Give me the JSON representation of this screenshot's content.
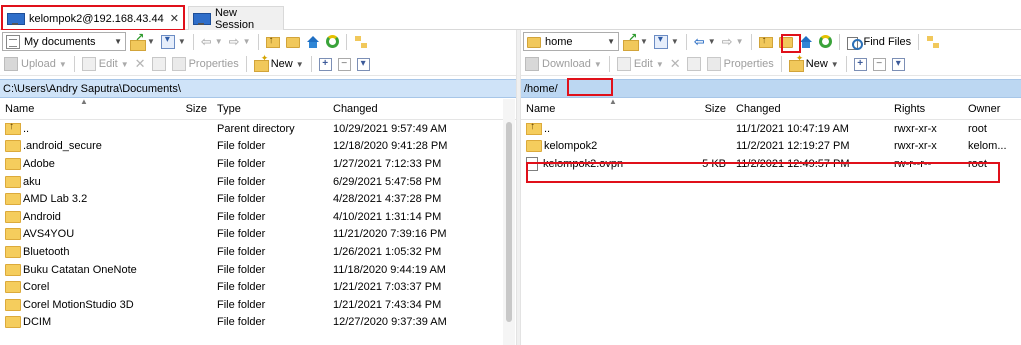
{
  "tabs": {
    "session_tab": "kelompok2@192.168.43.44",
    "close_glyph": "✕",
    "new_session": "New Session"
  },
  "left": {
    "location_combo": "My documents",
    "toolbar2": {
      "upload": "Upload",
      "edit": "Edit",
      "properties": "Properties",
      "new": "New"
    },
    "path": "C:\\Users\\Andry Saputra\\Documents\\",
    "columns": {
      "name": "Name",
      "size": "Size",
      "type": "Type",
      "changed": "Changed"
    },
    "rows": [
      {
        "name": "..",
        "type": "Parent directory",
        "changed": "10/29/2021  9:57:49 AM",
        "icon": "parent-folder"
      },
      {
        "name": ".android_secure",
        "type": "File folder",
        "changed": "12/18/2020  9:41:28 PM",
        "icon": "folder"
      },
      {
        "name": "Adobe",
        "type": "File folder",
        "changed": "1/27/2021  7:12:33 PM",
        "icon": "folder"
      },
      {
        "name": "aku",
        "type": "File folder",
        "changed": "6/29/2021  5:47:58 PM",
        "icon": "folder"
      },
      {
        "name": "AMD Lab 3.2",
        "type": "File folder",
        "changed": "4/28/2021  4:37:28 PM",
        "icon": "folder"
      },
      {
        "name": "Android",
        "type": "File folder",
        "changed": "4/10/2021  1:31:14 PM",
        "icon": "folder"
      },
      {
        "name": "AVS4YOU",
        "type": "File folder",
        "changed": "11/21/2020  7:39:16 PM",
        "icon": "folder"
      },
      {
        "name": "Bluetooth",
        "type": "File folder",
        "changed": "1/26/2021  1:05:32 PM",
        "icon": "folder"
      },
      {
        "name": "Buku Catatan OneNote",
        "type": "File folder",
        "changed": "11/18/2020  9:44:19 AM",
        "icon": "folder"
      },
      {
        "name": "Corel",
        "type": "File folder",
        "changed": "1/21/2021  7:03:37 PM",
        "icon": "folder"
      },
      {
        "name": "Corel MotionStudio 3D",
        "type": "File folder",
        "changed": "1/21/2021  7:43:34 PM",
        "icon": "folder"
      },
      {
        "name": "DCIM",
        "type": "File folder",
        "changed": "12/27/2020  9:37:39 AM",
        "icon": "folder"
      }
    ]
  },
  "right": {
    "location_combo": "home",
    "find_files": "Find Files",
    "toolbar2": {
      "download": "Download",
      "edit": "Edit",
      "properties": "Properties",
      "new": "New"
    },
    "path": "/home/",
    "columns": {
      "name": "Name",
      "size": "Size",
      "changed": "Changed",
      "rights": "Rights",
      "owner": "Owner"
    },
    "rows": [
      {
        "name": "..",
        "size": "",
        "changed": "11/1/2021 10:47:19 AM",
        "rights": "rwxr-xr-x",
        "owner": "root",
        "icon": "parent-folder"
      },
      {
        "name": "kelompok2",
        "size": "",
        "changed": "11/2/2021 12:19:27 PM",
        "rights": "rwxr-xr-x",
        "owner": "kelom...",
        "icon": "folder"
      },
      {
        "name": "kelompok2.ovpn",
        "size": "5 KB",
        "changed": "11/2/2021 12:49:57 PM",
        "rights": "rw-r--r--",
        "owner": "root",
        "icon": "file"
      }
    ]
  },
  "colors": {
    "highlight": "#e0101a",
    "pathbar_left": "#cfe3f8",
    "pathbar_right": "#bcd7f2",
    "folder": "#f5cd5d"
  }
}
